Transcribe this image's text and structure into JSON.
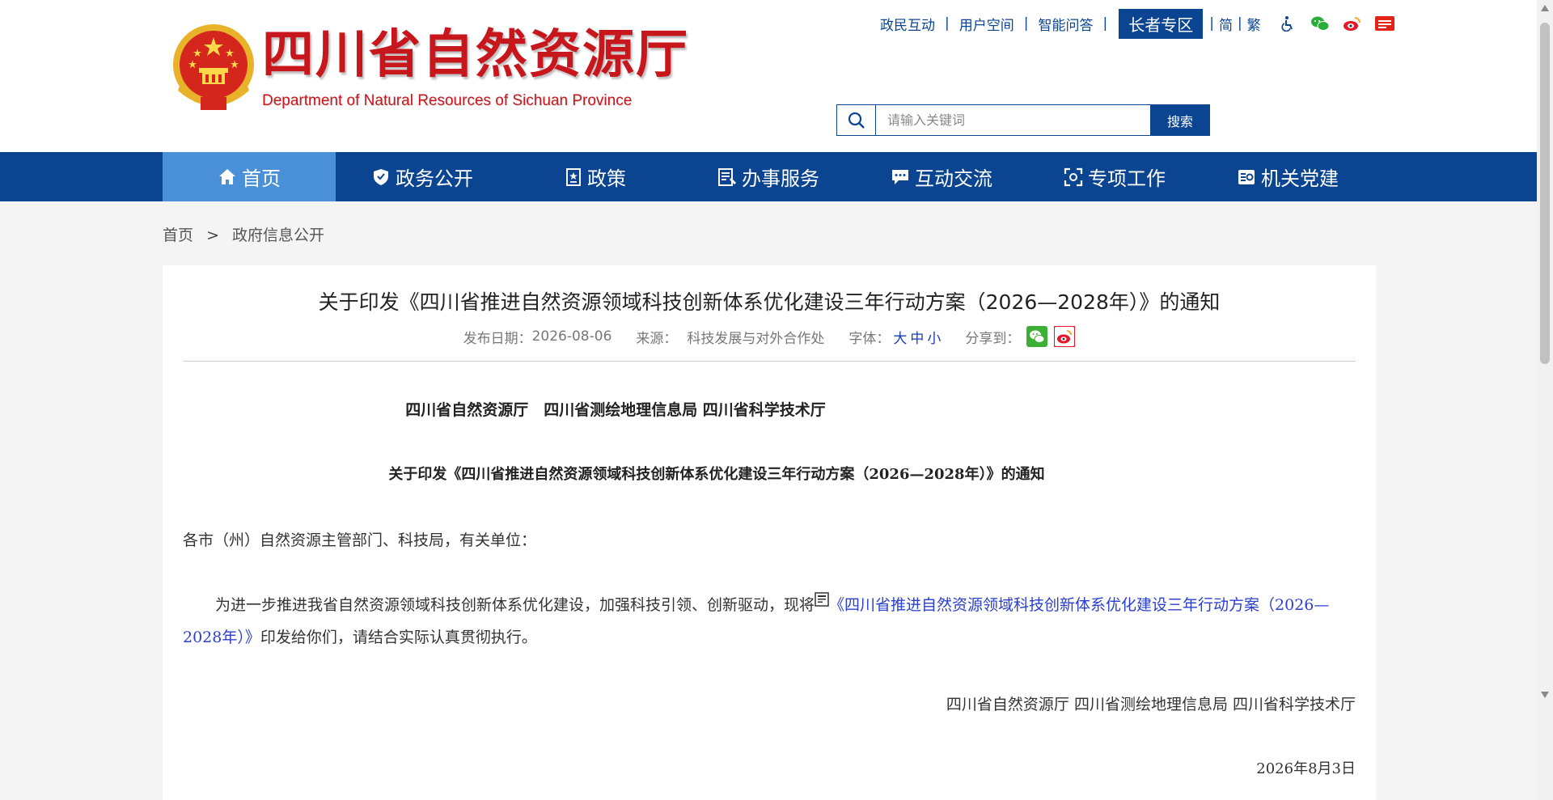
{
  "header": {
    "logo_cn": "四川省自然资源厅",
    "logo_en": "Department of Natural Resources of Sichuan Province",
    "top_links": [
      "政民互动",
      "用户空间",
      "智能问答"
    ],
    "elder_zone": "长者专区",
    "simplified": "简",
    "traditional": "繁",
    "icons": [
      "accessibility-icon",
      "wechat-icon",
      "weibo-icon",
      "toutiao-icon"
    ],
    "search": {
      "placeholder": "请输入关键词",
      "button": "搜索"
    }
  },
  "nav": {
    "items": [
      {
        "label": "首页",
        "icon": "home-icon"
      },
      {
        "label": "政务公开",
        "icon": "shield-icon"
      },
      {
        "label": "政策",
        "icon": "document-icon"
      },
      {
        "label": "办事服务",
        "icon": "service-icon"
      },
      {
        "label": "互动交流",
        "icon": "chat-icon"
      },
      {
        "label": "专项工作",
        "icon": "focus-icon"
      },
      {
        "label": "机关党建",
        "icon": "party-icon"
      }
    ],
    "active_index": 0
  },
  "breadcrumb": {
    "home": "首页",
    "separator": ">",
    "current": "政府信息公开"
  },
  "article": {
    "title": "关于印发《四川省推进自然资源领域科技创新体系优化建设三年行动方案（2026—2028年）》的通知",
    "meta": {
      "date_label": "发布日期：",
      "date": "2026-08-06",
      "source_label": "来源：",
      "source": "科技发展与对外合作处",
      "font_label": "字体：",
      "font_large": "大",
      "font_medium": "中",
      "font_small": "小",
      "share_label": "分享到："
    },
    "issuers": "四川省自然资源厅　四川省测绘地理信息局 四川省科学技术厅",
    "doc_title": "关于印发《四川省推进自然资源领域科技创新体系优化建设三年行动方案（2026—2028年）》的通知",
    "salutation": "各市（州）自然资源主管部门、科技局，有关单位：",
    "body_before": "为进一步推进我省自然资源领域科技创新体系优化建设，加强科技引领、创新驱动，现将",
    "body_link": "《四川省推进自然资源领域科技创新体系优化建设三年行动方案（2026—2028年）》",
    "body_after": "印发给你们，请结合实际认真贯彻执行。",
    "signature": "四川省自然资源厅 四川省测绘地理信息局 四川省科学技术厅",
    "date": "2026年8月3日"
  },
  "colors": {
    "primary": "#0b4592",
    "active_nav": "#4a90d9",
    "logo_red": "#c8161d",
    "link": "#2a3fcf"
  }
}
